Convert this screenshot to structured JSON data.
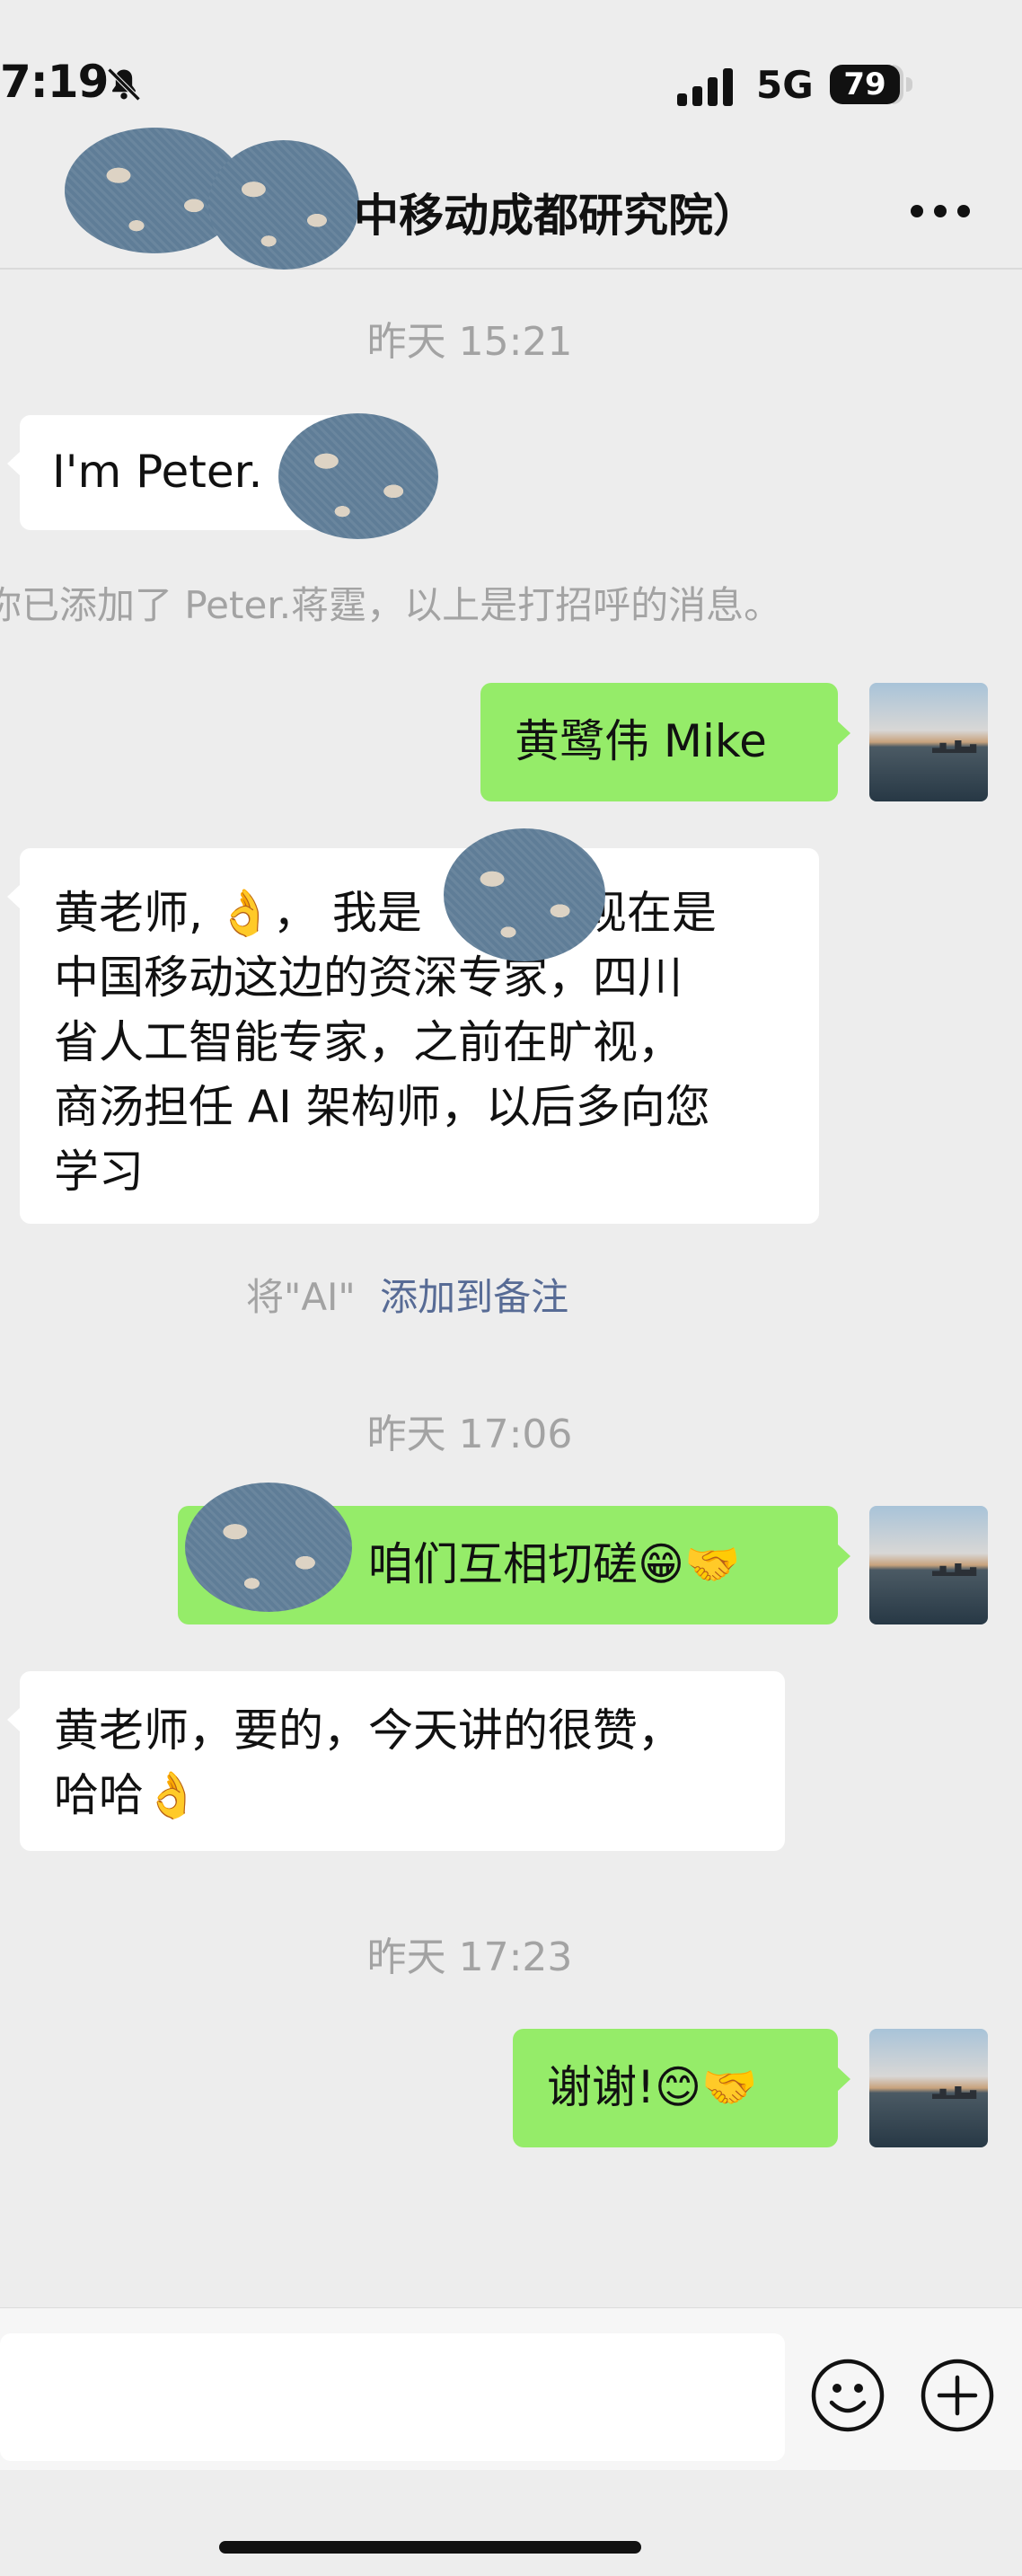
{
  "status_bar": {
    "time": "7:19",
    "network": "5G",
    "battery": "79"
  },
  "header": {
    "title": "中移动成都研究院）"
  },
  "messages": {
    "ts1": "昨天 15:21",
    "m1_text": "I'm Peter.",
    "sys1": "你已添加了 Peter.蒋霆，以上是打招呼的消息。",
    "m2_text": "黄鹭伟 Mike",
    "m3_line1": "黄老师, 👌， 我是",
    "m3_line1b": "现在是",
    "m3_line2": "中国移动这边的资深专家，四川",
    "m3_line3": "省人工智能专家，之前在旷视，",
    "m3_line4": "商汤担任 AI 架构师，以后多向您",
    "m3_line5": "学习",
    "sys2_prefix": "将\"AI\"",
    "sys2_link": "添加到备注",
    "ts2": "昨天 17:06",
    "m4_text": "咱们互相切磋😁🤝",
    "m5_line1": "黄老师，要的，今天讲的很赞，",
    "m5_line2": "哈哈👌",
    "ts3": "昨天 17:23",
    "m6_text": "谢谢!😊🤝"
  },
  "icons": {
    "bell": "bell-slash-icon",
    "signal": "cellular-signal-icon",
    "battery": "battery-icon",
    "more": "more-dots-icon",
    "emoji": "emoji-icon",
    "plus": "plus-icon"
  },
  "colors": {
    "background": "#ededed",
    "bubble_sent": "#95ec69",
    "bubble_received": "#ffffff",
    "timestamp": "#a3a3a3",
    "link": "#576b95"
  }
}
